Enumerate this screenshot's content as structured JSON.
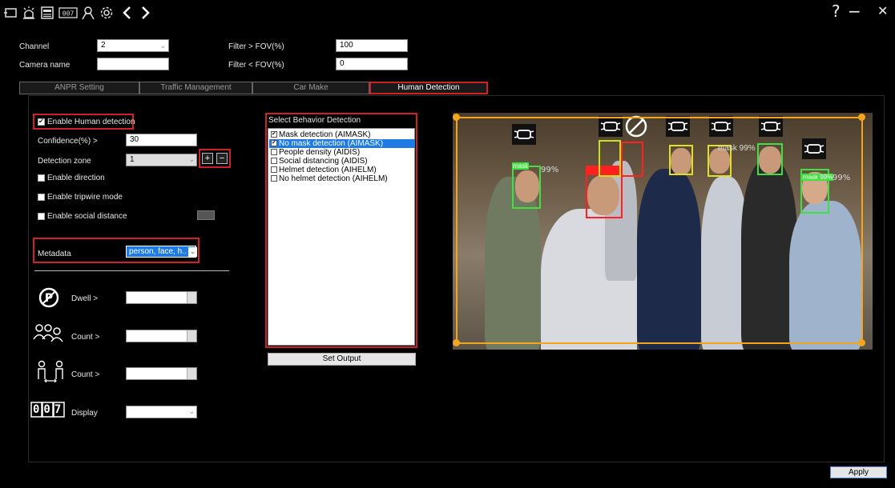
{
  "window": {
    "help_label": "?",
    "minimize_label": "−",
    "close_label": "✕"
  },
  "toolbar": {
    "icons": [
      "window-icon",
      "alarm-icon",
      "display-icon",
      "counter-icon",
      "user-icon",
      "gear-icon",
      "chevron-left-icon",
      "chevron-right-icon"
    ],
    "counter_text": "007"
  },
  "top": {
    "channel_label": "Channel",
    "channel_value": "2",
    "camera_name_label": "Camera name",
    "camera_name_value": "",
    "filter_gt_label": "Filter > FOV(%)",
    "filter_gt_value": "100",
    "filter_lt_label": "Filter < FOV(%)",
    "filter_lt_value": "0"
  },
  "tabs": [
    {
      "label": "ANPR Setting",
      "active": false
    },
    {
      "label": "Traffic Management",
      "active": false
    },
    {
      "label": "Car Make",
      "active": false
    },
    {
      "label": "Human Detection",
      "active": true
    }
  ],
  "left": {
    "enable_human_label": "Enable Human detection",
    "enable_human_checked": true,
    "confidence_label": "Confidence(%) >",
    "confidence_value": "30",
    "zone_label": "Detection zone",
    "zone_value": "1",
    "zone_add": "+",
    "zone_remove": "−",
    "enable_direction_label": "Enable direction",
    "enable_tripwire_label": "Enable tripwire mode",
    "enable_social_label": "Enable social distance",
    "metadata_label": "Metadata",
    "metadata_value": "person, face, h..",
    "dwell_label": "Dwell >",
    "count1_label": "Count >",
    "count2_label": "Count >",
    "display_label": "Display",
    "display_counter_text": "007"
  },
  "behavior": {
    "title": "Select Behavior Detection",
    "items": [
      {
        "label": "Mask detection (AIMASK)",
        "checked": true,
        "selected": false
      },
      {
        "label": "No mask detection (AIMASK)",
        "checked": true,
        "selected": true
      },
      {
        "label": "People density (AIDIS)",
        "checked": false,
        "selected": false
      },
      {
        "label": "Social distancing (AIDIS)",
        "checked": false,
        "selected": false
      },
      {
        "label": "Helmet detection (AIHELM)",
        "checked": false,
        "selected": false
      },
      {
        "label": "No helmet detection (AIHELM)",
        "checked": false,
        "selected": false
      }
    ],
    "set_output_label": "Set Output"
  },
  "video": {
    "tags": [
      "mask",
      "mask 99%",
      "mask 99%",
      "99%",
      "99%"
    ]
  },
  "apply_label": "Apply",
  "colors": {
    "highlight": "#d0202a",
    "selection": "#1e7be6",
    "zone": "#f5a51c",
    "mask_box": "#3fe03f",
    "nomask_box": "#ff2020"
  }
}
